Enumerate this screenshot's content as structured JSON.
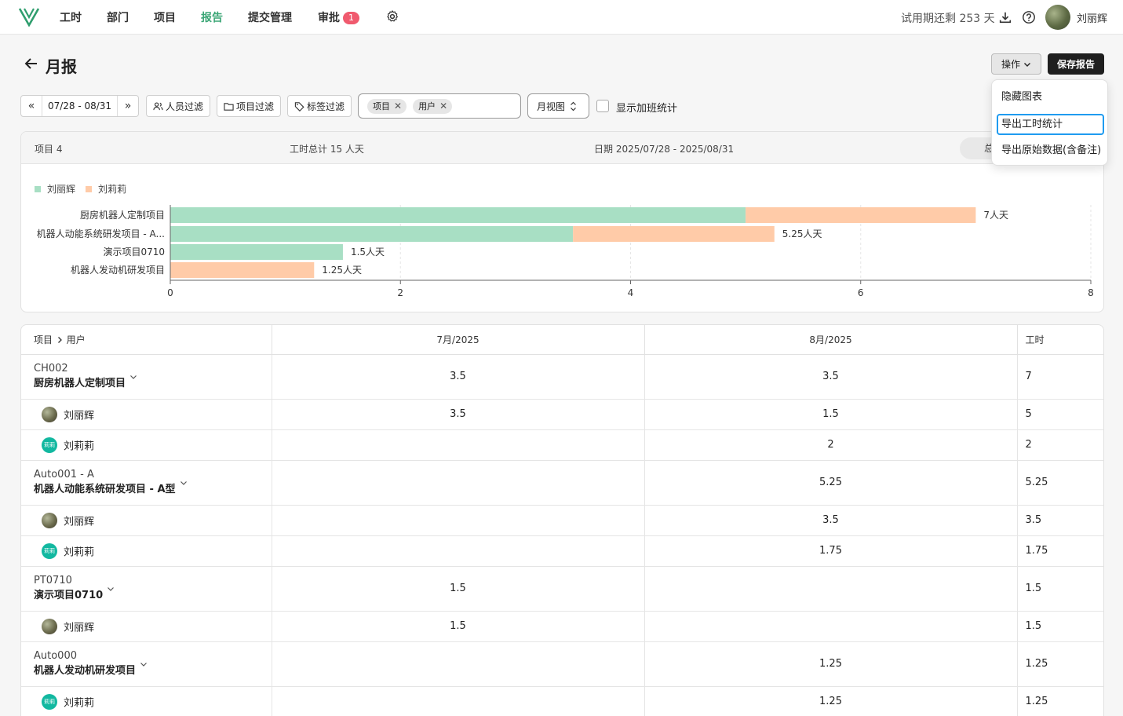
{
  "nav": {
    "items": [
      {
        "label": "工时"
      },
      {
        "label": "部门"
      },
      {
        "label": "项目"
      },
      {
        "label": "报告"
      },
      {
        "label": "提交管理"
      },
      {
        "label": "审批",
        "badge": "1"
      }
    ],
    "active": "报告",
    "trial": "试用期还剩 253 天",
    "user": "刘丽辉",
    "icons": [
      "logo-icon",
      "gear-icon",
      "download-icon",
      "help-icon",
      "avatar"
    ]
  },
  "page": {
    "title": "月报",
    "actions_label": "操作",
    "save_label": "保存报告"
  },
  "dropdown": {
    "items": [
      "隐藏图表",
      "导出工时统计",
      "导出原始数据(含备注)"
    ],
    "focused_index": 1
  },
  "filters": {
    "date_range": "07/28 - 08/31",
    "people_filter": "人员过滤",
    "project_filter": "项目过滤",
    "tag_filter": "标签过滤",
    "group_chips": [
      "项目",
      "用户"
    ],
    "view": "月视图",
    "overtime_label": "显示加班统计",
    "overtime_checked": false
  },
  "summary": {
    "projects": "项目 4",
    "total": "工时总计 15 人天",
    "dates": "日期 2025/07/28 - 2025/08/31",
    "pill": "总"
  },
  "chart_data": {
    "type": "bar",
    "orientation": "horizontal",
    "stacked": true,
    "categories": [
      "厨房机器人定制项目",
      "机器人动能系统研发项目 - A...",
      "演示项目0710",
      "机器人发动机研发项目"
    ],
    "series": [
      {
        "name": "刘丽辉",
        "color": "#a8dfc4",
        "values": [
          5,
          3.5,
          1.5,
          0
        ]
      },
      {
        "name": "刘莉莉",
        "color": "#ffcba8",
        "values": [
          2,
          1.75,
          0,
          1.25
        ]
      }
    ],
    "totals_labels": [
      "7人天",
      "5.25人天",
      "1.5人天",
      "1.25人天"
    ],
    "xlim": [
      0,
      8
    ],
    "xticks": [
      "0",
      "2",
      "4",
      "6",
      "8"
    ],
    "legend_position": "top-left",
    "grid": true
  },
  "table": {
    "headers": [
      "项目",
      "用户",
      "7月/2025",
      "8月/2025",
      "工时"
    ],
    "projects": [
      {
        "code": "CH002",
        "name": "厨房机器人定制项目",
        "jul": "3.5",
        "aug": "3.5",
        "total": "7",
        "users": [
          {
            "name": "刘丽辉",
            "avatar": "photo",
            "jul": "3.5",
            "aug": "1.5",
            "total": "5"
          },
          {
            "name": "刘莉莉",
            "avatar": "teal",
            "avatar_text": "莉莉",
            "jul": "",
            "aug": "2",
            "total": "2"
          }
        ]
      },
      {
        "code": "Auto001 - A",
        "name": "机器人动能系统研发项目 - A型",
        "jul": "",
        "aug": "5.25",
        "total": "5.25",
        "users": [
          {
            "name": "刘丽辉",
            "avatar": "photo",
            "jul": "",
            "aug": "3.5",
            "total": "3.5"
          },
          {
            "name": "刘莉莉",
            "avatar": "teal",
            "avatar_text": "莉莉",
            "jul": "",
            "aug": "1.75",
            "total": "1.75"
          }
        ]
      },
      {
        "code": "PT0710",
        "name": "演示项目0710",
        "jul": "1.5",
        "aug": "",
        "total": "1.5",
        "users": [
          {
            "name": "刘丽辉",
            "avatar": "photo",
            "jul": "1.5",
            "aug": "",
            "total": "1.5"
          }
        ]
      },
      {
        "code": "Auto000",
        "name": "机器人发动机研发项目",
        "jul": "",
        "aug": "1.25",
        "total": "1.25",
        "users": [
          {
            "name": "刘莉莉",
            "avatar": "teal",
            "avatar_text": "莉莉",
            "jul": "",
            "aug": "1.25",
            "total": "1.25"
          }
        ]
      }
    ]
  },
  "colors": {
    "accent": "#3ba676",
    "badge": "#f05a6e",
    "series1": "#a8dfc4",
    "series2": "#ffcba8",
    "focus": "#1f9bf0"
  }
}
